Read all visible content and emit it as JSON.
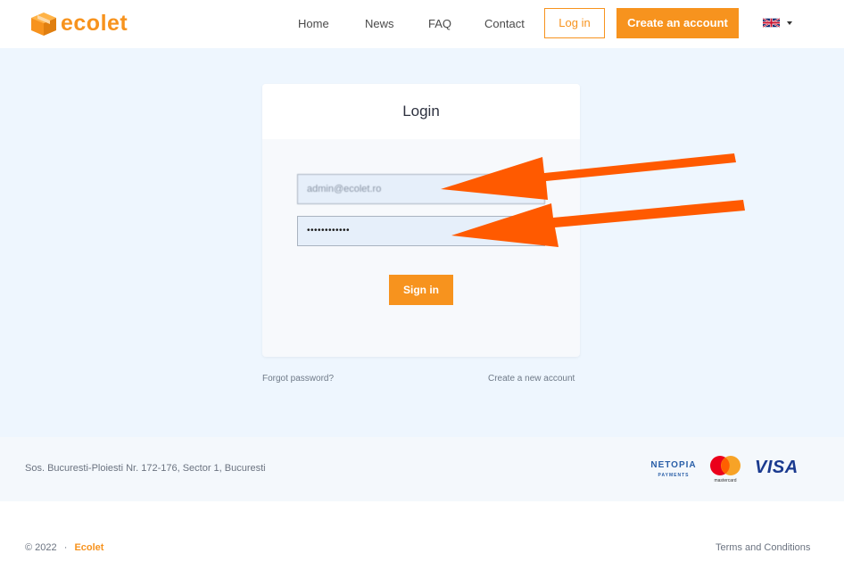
{
  "brand": {
    "logo_text": "ecolet",
    "color": "#f7931e"
  },
  "nav": {
    "home": "Home",
    "news": "News",
    "faq": "FAQ",
    "contact": "Contact",
    "login": "Log in",
    "create_account": "Create an account",
    "language_icon": "uk-flag-icon"
  },
  "login_card": {
    "title": "Login",
    "email_value": "admin@ecolet.ro",
    "password_value": "••••••••••••",
    "signin_label": "Sign in",
    "forgot_password": "Forgot password?",
    "create_new_account": "Create a new account"
  },
  "footer": {
    "address": "Sos. Bucuresti-Ploiesti Nr. 172-176, Sector 1, Bucuresti",
    "payments": {
      "netopia_line1": "NETOPIA",
      "netopia_line2": "PAYMENTS",
      "mastercard": "mastercard",
      "visa": "VISA"
    },
    "copyright_year": "© 2022",
    "copyright_sep": "·",
    "copyright_brand": "Ecolet",
    "terms": "Terms and Conditions"
  },
  "colors": {
    "accent": "#f7931e",
    "arrow": "#ff5a00",
    "page_bg": "#eef6fe",
    "visa_blue": "#1a3a8f"
  }
}
